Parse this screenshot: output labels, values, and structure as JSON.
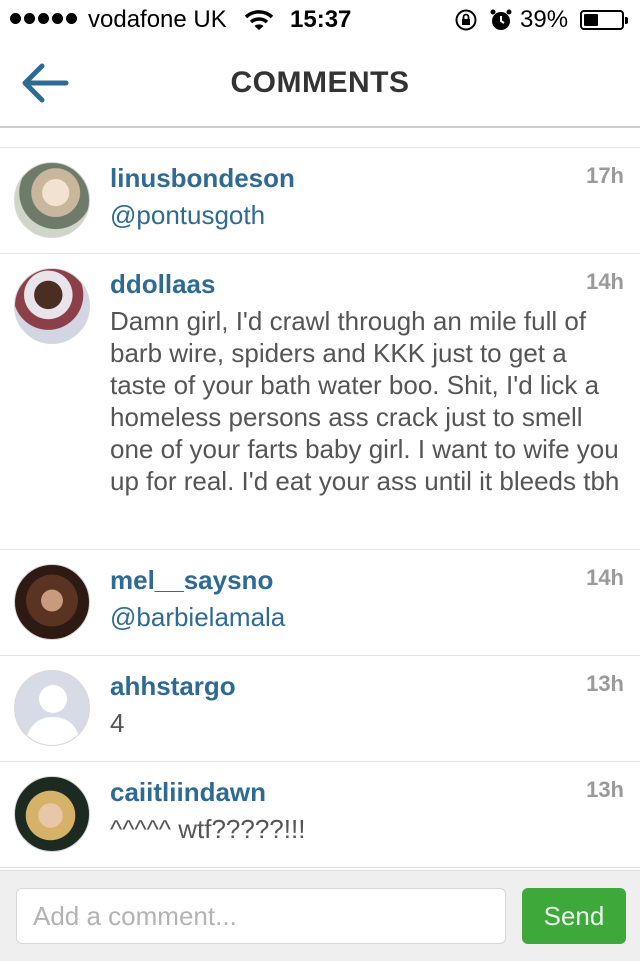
{
  "status_bar": {
    "carrier": "vodafone UK",
    "time": "15:37",
    "battery": "39%",
    "battery_level": 0.39,
    "icons": [
      "signal-dots-icon",
      "wifi-icon",
      "rotation-lock-icon",
      "alarm-icon",
      "battery-icon"
    ]
  },
  "header": {
    "back_icon": "back-arrow-icon",
    "title": "COMMENTS"
  },
  "comments": [
    {
      "username": "linusbondeson",
      "time": "17h",
      "text": "@pontusgoth",
      "is_mention": true
    },
    {
      "username": "ddollaas",
      "time": "14h",
      "text": "Damn girl, I'd crawl through an mile full of barb wire, spiders and KKK just to get a taste of your bath water boo. Shit, I'd lick a homeless persons ass crack just to smell one of your farts baby girl. I want to wife you up for real. I'd eat your ass until it bleeds tbh",
      "is_mention": false
    },
    {
      "username": "mel__saysno",
      "time": "14h",
      "text": "@barbielamala",
      "is_mention": true
    },
    {
      "username": "ahhstargo",
      "time": "13h",
      "text": "4",
      "is_mention": false
    },
    {
      "username": "caiitliindawn",
      "time": "13h",
      "text": "^^^^^ wtf?????!!!",
      "is_mention": false
    }
  ],
  "compose": {
    "placeholder": "Add a comment...",
    "value": "",
    "send_label": "Send"
  },
  "colors": {
    "username": "#2f6a93",
    "send_button": "#3fa83a",
    "timestamp": "#9a9a9a"
  }
}
